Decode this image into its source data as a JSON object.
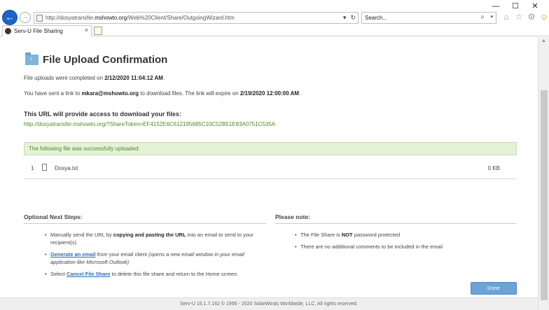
{
  "browser": {
    "window_controls": [
      "—",
      "☐",
      "✕"
    ],
    "back_glyph": "←",
    "forward_glyph": "→",
    "url_prefix": "http://dosyatransfer.",
    "url_host": "mshowto.org",
    "url_path": "/Web%20Client/Share/OutgoingWizard.htm",
    "search_placeholder": "Search...",
    "tab_title": "Serv-U File Sharing",
    "tab_close": "×"
  },
  "page": {
    "title": "File Upload Confirmation",
    "completed_prefix": "File uploads were completed on ",
    "completed_time": "2/12/2020 11:04:12 AM",
    "completed_suffix": ".",
    "sent_prefix": "You have sent a link to ",
    "sent_email": "mkara@mshowto.org",
    "sent_middle": " to download files. The link will expire on ",
    "expire_time": "2/19/2020 12:00:00 AM",
    "sent_suffix": ".",
    "url_heading": "This URL will provide access to download your files:",
    "share_url": "http://dosyatransfer.mshowto.org/?ShareToken=EF4152E6C612195685C10C52B51E83A0751C535A",
    "success_message": "The following file was successfully uploaded:",
    "files": [
      {
        "index": "1",
        "name": "Dosya.txt",
        "size": "0 KB"
      }
    ]
  },
  "next_steps": {
    "title": "Optional Next Steps:",
    "item1_prefix": "Manually send the URL by ",
    "item1_bold": "copying and pasting the URL",
    "item1_suffix": " into an email to send to your recipient(s)",
    "item2_link": "Generate an email",
    "item2_middle": " from your email client ",
    "item2_italic": "(opens a new email window in your email application like Microsoft Outlook)",
    "item3_prefix": "Select ",
    "item3_link": "Cancel File Share",
    "item3_suffix": " to delete this file share and return to the Home screen"
  },
  "note": {
    "title": "Please note:",
    "item1_prefix": "The File Share is ",
    "item1_bold": "NOT",
    "item1_suffix": " password protected",
    "item2": "There are no additional comments to be included in the email"
  },
  "done_label": "Done",
  "footer": "Serv-U 15.1.7.162 © 1995 - 2020 SolarWinds Worldwide, LLC. All rights reserved.",
  "colors": {
    "link_blue": "#2a6fb5",
    "success_green": "#4f8a28",
    "success_bg": "#e5f2d8",
    "button_blue": "#6aa4d9"
  }
}
